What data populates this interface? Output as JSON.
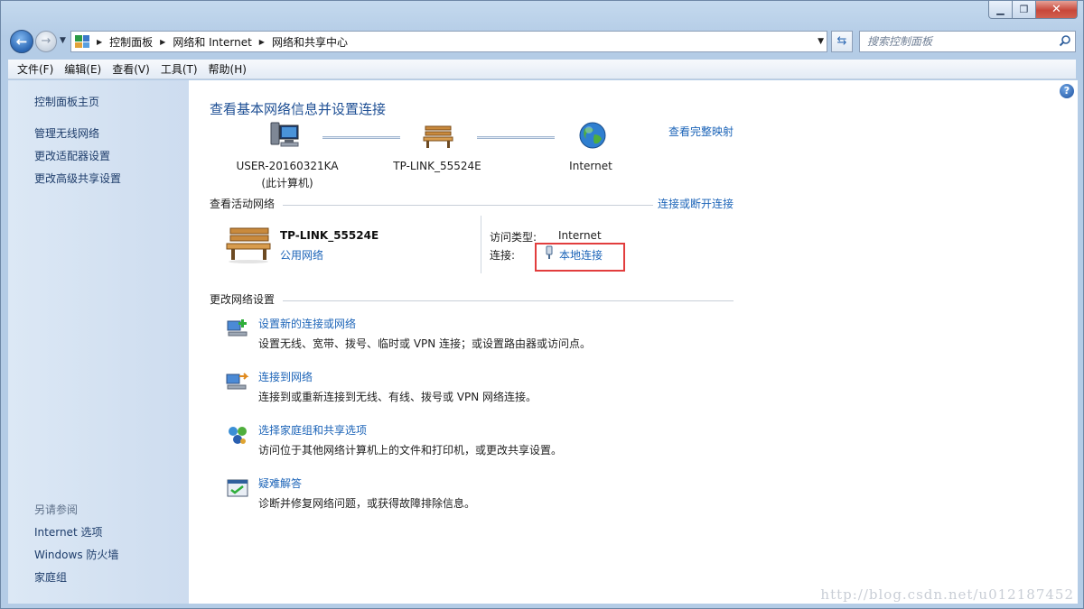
{
  "window": {
    "min_icon": "minimize-icon",
    "max_icon": "maximize-icon",
    "close_icon": "close-icon"
  },
  "address": {
    "crumbs": [
      "控制面板",
      "网络和 Internet",
      "网络和共享中心"
    ],
    "search_placeholder": "搜索控制面板"
  },
  "menu": [
    "文件(F)",
    "编辑(E)",
    "查看(V)",
    "工具(T)",
    "帮助(H)"
  ],
  "sidebar": {
    "home": "控制面板主页",
    "links": [
      "管理无线网络",
      "更改适配器设置",
      "更改高级共享设置"
    ],
    "see_also_heading": "另请参阅",
    "see_also": [
      "Internet 选项",
      "Windows 防火墙",
      "家庭组"
    ]
  },
  "main": {
    "title": "查看基本网络信息并设置连接",
    "full_map": "查看完整映射",
    "map": {
      "computer_name": "USER-20160321KA",
      "computer_sub": "(此计算机)",
      "network_name": "TP-LINK_55524E",
      "internet": "Internet"
    },
    "active_heading": "查看活动网络",
    "connect_disconnect": "连接或断开连接",
    "active_network": {
      "name": "TP-LINK_55524E",
      "type": "公用网络",
      "access_label": "访问类型:",
      "access_value": "Internet",
      "conn_label": "连接:",
      "conn_value": "本地连接"
    },
    "change_heading": "更改网络设置",
    "tasks": [
      {
        "link": "设置新的连接或网络",
        "desc": "设置无线、宽带、拨号、临时或 VPN 连接；或设置路由器或访问点。"
      },
      {
        "link": "连接到网络",
        "desc": "连接到或重新连接到无线、有线、拨号或 VPN 网络连接。"
      },
      {
        "link": "选择家庭组和共享选项",
        "desc": "访问位于其他网络计算机上的文件和打印机，或更改共享设置。"
      },
      {
        "link": "疑难解答",
        "desc": "诊断并修复网络问题，或获得故障排除信息。"
      }
    ]
  },
  "watermark": "http://blog.csdn.net/u012187452",
  "colors": {
    "link": "#1c64b8",
    "title": "#1e4f94",
    "highlight_box": "#e23d3d"
  }
}
